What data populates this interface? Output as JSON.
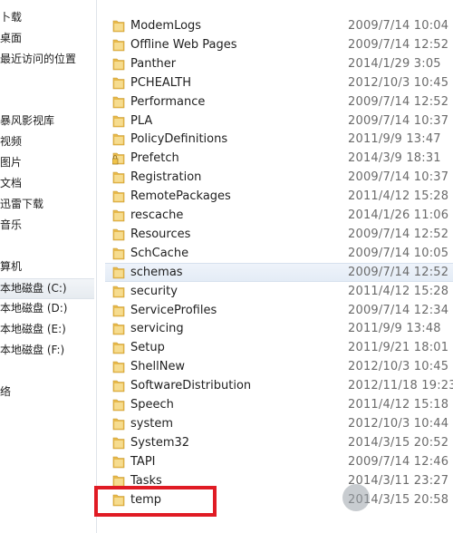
{
  "nav": {
    "items": [
      {
        "label": "卜载"
      },
      {
        "label": "桌面"
      },
      {
        "label": "最近访问的位置"
      },
      {
        "label": "暴风影视库"
      },
      {
        "label": "视频"
      },
      {
        "label": "图片"
      },
      {
        "label": "文档"
      },
      {
        "label": "迅雷下载"
      },
      {
        "label": "音乐"
      },
      {
        "label": "算机"
      },
      {
        "label": "本地磁盘 (C:)"
      },
      {
        "label": "本地磁盘 (D:)"
      },
      {
        "label": "本地磁盘 (E:)"
      },
      {
        "label": "本地磁盘 (F:)"
      },
      {
        "label": "络"
      }
    ]
  },
  "files": [
    {
      "name": "ModemLogs",
      "date": "2009/7/14 10:04",
      "icon": "folder-icon"
    },
    {
      "name": "Offline Web Pages",
      "date": "2009/7/14 12:52",
      "icon": "folder-icon"
    },
    {
      "name": "Panther",
      "date": "2014/1/29 3:05",
      "icon": "folder-icon"
    },
    {
      "name": "PCHEALTH",
      "date": "2012/10/3 10:45",
      "icon": "folder-icon"
    },
    {
      "name": "Performance",
      "date": "2009/7/14 12:52",
      "icon": "folder-icon"
    },
    {
      "name": "PLA",
      "date": "2009/7/14 10:37",
      "icon": "folder-icon"
    },
    {
      "name": "PolicyDefinitions",
      "date": "2011/9/9 13:47",
      "icon": "folder-icon"
    },
    {
      "name": "Prefetch",
      "date": "2014/3/9 18:31",
      "icon": "locked-folder-icon"
    },
    {
      "name": "Registration",
      "date": "2009/7/14 10:37",
      "icon": "folder-icon"
    },
    {
      "name": "RemotePackages",
      "date": "2011/4/12 15:28",
      "icon": "folder-icon"
    },
    {
      "name": "rescache",
      "date": "2014/1/26 11:06",
      "icon": "folder-icon"
    },
    {
      "name": "Resources",
      "date": "2009/7/14 12:52",
      "icon": "folder-icon"
    },
    {
      "name": "SchCache",
      "date": "2009/7/14 10:05",
      "icon": "folder-icon"
    },
    {
      "name": "schemas",
      "date": "2009/7/14 12:52",
      "icon": "folder-icon"
    },
    {
      "name": "security",
      "date": "2011/4/12 15:28",
      "icon": "folder-icon"
    },
    {
      "name": "ServiceProfiles",
      "date": "2009/7/14 12:34",
      "icon": "folder-icon"
    },
    {
      "name": "servicing",
      "date": "2011/9/9 13:48",
      "icon": "folder-icon"
    },
    {
      "name": "Setup",
      "date": "2011/9/21 18:01",
      "icon": "folder-icon"
    },
    {
      "name": "ShellNew",
      "date": "2012/10/3 10:45",
      "icon": "folder-icon"
    },
    {
      "name": "SoftwareDistribution",
      "date": "2012/11/18 19:23",
      "icon": "folder-icon"
    },
    {
      "name": "Speech",
      "date": "2011/4/12 15:18",
      "icon": "folder-icon"
    },
    {
      "name": "system",
      "date": "2012/10/3 10:44",
      "icon": "folder-icon"
    },
    {
      "name": "System32",
      "date": "2014/3/15 20:52",
      "icon": "folder-icon"
    },
    {
      "name": "TAPI",
      "date": "2009/7/14 12:46",
      "icon": "folder-icon"
    },
    {
      "name": "Tasks",
      "date": "2014/3/11 23:27",
      "icon": "folder-icon"
    },
    {
      "name": "temp",
      "date": "2014/3/15 20:58",
      "icon": "folder-icon"
    }
  ],
  "colors": {
    "highlight_box": "#e01b24",
    "folder": "#e8b94a"
  }
}
